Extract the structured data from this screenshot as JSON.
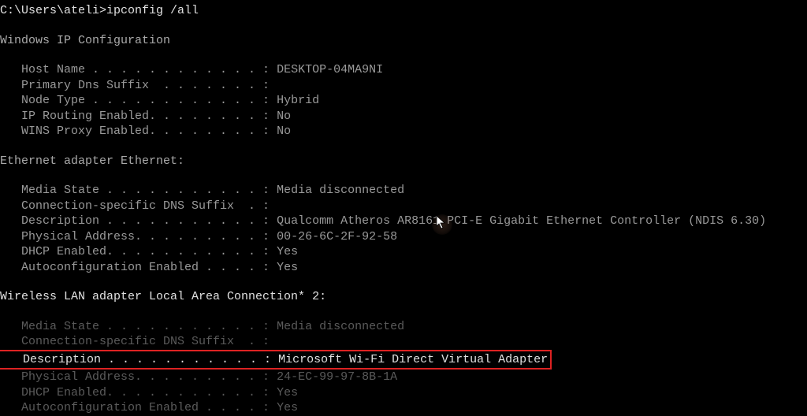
{
  "prompt": "C:\\Users\\ateli>ipconfig /all",
  "sect1_header": "Windows IP Configuration",
  "sect1": {
    "host_name_label": "   Host Name . . . . . . . . . . . . : ",
    "host_name_value": "DESKTOP-04MA9NI",
    "primary_dns_label": "   Primary Dns Suffix  . . . . . . . :",
    "node_type_label": "   Node Type . . . . . . . . . . . . : ",
    "node_type_value": "Hybrid",
    "ip_routing_label": "   IP Routing Enabled. . . . . . . . : ",
    "ip_routing_value": "No",
    "wins_proxy_label": "   WINS Proxy Enabled. . . . . . . . : ",
    "wins_proxy_value": "No"
  },
  "sect2_header": "Ethernet adapter Ethernet:",
  "sect2": {
    "media_state_label": "   Media State . . . . . . . . . . . : ",
    "media_state_value": "Media disconnected",
    "dns_suffix_label": "   Connection-specific DNS Suffix  . :",
    "description_label": "   Description . . . . . . . . . . . : ",
    "description_value": "Qualcomm Atheros AR8161 PCI-E Gigabit Ethernet Controller (NDIS 6.30)",
    "phys_addr_label": "   Physical Address. . . . . . . . . : ",
    "phys_addr_value": "00-26-6C-2F-92-58",
    "dhcp_label": "   DHCP Enabled. . . . . . . . . . . : ",
    "dhcp_value": "Yes",
    "autoconf_label": "   Autoconfiguration Enabled . . . . : ",
    "autoconf_value": "Yes"
  },
  "sect3_header": "Wireless LAN adapter Local Area Connection* 2:",
  "sect3": {
    "media_state_label": "   Media State . . . . . . . . . . . : ",
    "media_state_value": "Media disconnected",
    "dns_suffix_label": "   Connection-specific DNS Suffix  . :",
    "description_label": "   Description . . . . . . . . . . . : ",
    "description_value": "Microsoft Wi-Fi Direct Virtual Adapter",
    "phys_addr_label": "   Physical Address. . . . . . . . . : ",
    "phys_addr_value": "24-EC-99-97-8B-1A",
    "dhcp_label": "   DHCP Enabled. . . . . . . . . . . : ",
    "dhcp_value": "Yes",
    "autoconf_label": "   Autoconfiguration Enabled . . . . : ",
    "autoconf_value": "Yes"
  }
}
